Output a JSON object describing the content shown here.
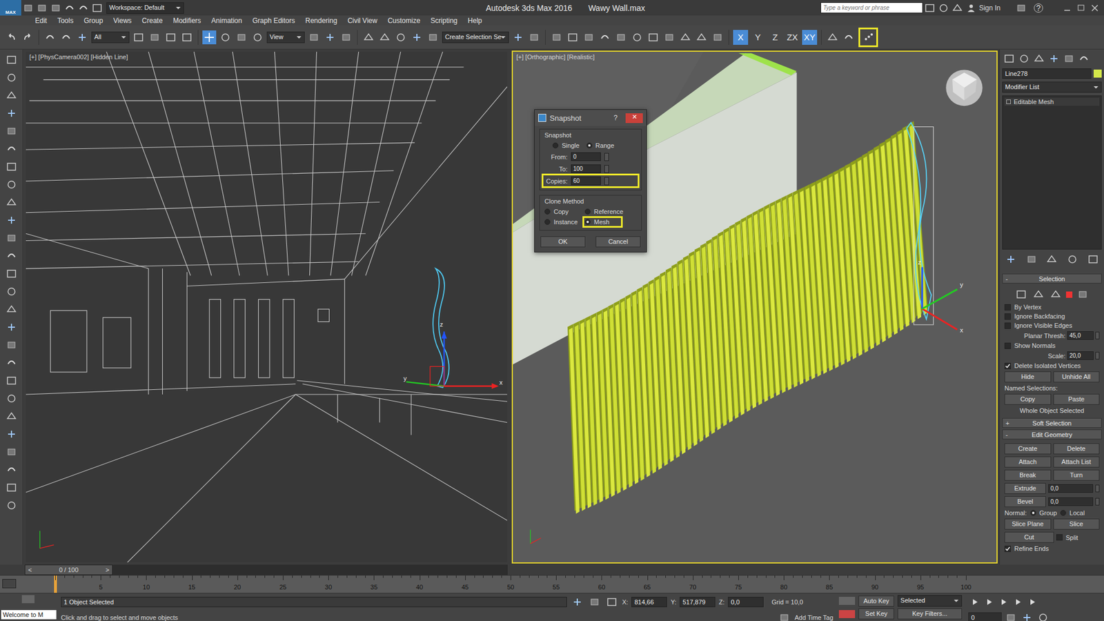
{
  "window": {
    "app_badge": "MAX",
    "workspace": "Workspace: Default",
    "title": "Autodesk 3ds Max 2016",
    "file": "Wawy Wall.max",
    "search_placeholder": "Type a keyword or phrase",
    "sign_in": "Sign In",
    "help": "?"
  },
  "menu": [
    "Edit",
    "Tools",
    "Group",
    "Views",
    "Create",
    "Modifiers",
    "Animation",
    "Graph Editors",
    "Rendering",
    "Civil View",
    "Customize",
    "Scripting",
    "Help"
  ],
  "toolbar": {
    "selection_filter": "All",
    "ref_coord": "View",
    "named_selection": "Create Selection Se",
    "axes": [
      {
        "label": "X",
        "selected": true
      },
      {
        "label": "Y",
        "selected": false
      },
      {
        "label": "Z",
        "selected": false
      },
      {
        "label": "ZX",
        "selected": false
      },
      {
        "label": "XY",
        "selected": true
      }
    ],
    "snapshot_highlighted": true
  },
  "viewports": [
    {
      "label": "[+] [PhysCamera002] [Hidden Line]",
      "active": false,
      "axes": [
        "x",
        "y",
        "z"
      ]
    },
    {
      "label": "[+] [Orthographic] [Realistic]",
      "active": true,
      "axes": [
        "x",
        "y",
        "z"
      ]
    }
  ],
  "snapshot": {
    "title": "Snapshot",
    "help": "?",
    "close": "✕",
    "group": "Snapshot",
    "modes": [
      {
        "label": "Single",
        "selected": false
      },
      {
        "label": "Range",
        "selected": true
      }
    ],
    "from": {
      "label": "From:",
      "value": "0"
    },
    "to": {
      "label": "To:",
      "value": "100"
    },
    "copies": {
      "label": "Copies:",
      "value": "60",
      "highlighted": true
    },
    "clone_group": "Clone Method",
    "methods": [
      {
        "label": "Copy",
        "selected": false,
        "highlighted": false
      },
      {
        "label": "Reference",
        "selected": false,
        "highlighted": false
      },
      {
        "label": "Instance",
        "selected": false,
        "highlighted": false
      },
      {
        "label": "Mesh",
        "selected": true,
        "highlighted": true
      }
    ],
    "buttons": [
      "OK",
      "Cancel"
    ]
  },
  "command_panel": {
    "object_name": "Line278",
    "object_color": "#d4e84a",
    "modifier_list": "Modifier List",
    "stack": [
      {
        "label": "Editable Mesh",
        "selected": false
      }
    ],
    "selection": {
      "header": "Selection",
      "collapse": "-",
      "options": [
        {
          "label": "By Vertex",
          "checked": false
        },
        {
          "label": "Ignore Backfacing",
          "checked": false
        },
        {
          "label": "Ignore Visible Edges",
          "checked": false
        }
      ],
      "planar_label": "Planar Thresh:",
      "planar_value": "45,0",
      "show_normals": {
        "label": "Show Normals",
        "checked": false
      },
      "scale_label": "Scale:",
      "scale_value": "20,0",
      "delete_isolated": {
        "label": "Delete Isolated Vertices",
        "checked": true
      },
      "buttons": [
        "Hide",
        "Unhide All"
      ],
      "named_label": "Named Selections:",
      "named_buttons": [
        "Copy",
        "Paste"
      ],
      "info": "Whole Object Selected"
    },
    "soft_selection": {
      "header": "Soft Selection",
      "collapse": "+"
    },
    "edit_geometry": {
      "header": "Edit Geometry",
      "collapse": "-",
      "button_rows": [
        [
          "Create",
          "Delete"
        ],
        [
          "Attach",
          "Attach List"
        ],
        [
          "Break",
          "Turn"
        ]
      ],
      "spinners": [
        {
          "label": "Extrude",
          "value": "0,0"
        },
        {
          "label": "Bevel",
          "value": "0,0"
        }
      ],
      "normal_label": "Normal:",
      "normal_modes": [
        {
          "label": "Group",
          "selected": true
        },
        {
          "label": "Local",
          "selected": false
        }
      ],
      "slice_buttons": [
        "Slice Plane",
        "Slice"
      ],
      "cut": "Cut",
      "split": {
        "label": "Split",
        "checked": false
      },
      "refine_ends": {
        "label": "Refine Ends",
        "checked": true
      }
    }
  },
  "timeline": {
    "position": "0 / 100",
    "prev": "<",
    "next": ">",
    "level": 0,
    "ticks": [
      "5",
      "10",
      "15",
      "20",
      "25",
      "30",
      "35",
      "40",
      "45",
      "50",
      "55",
      "60",
      "65",
      "70",
      "75",
      "80",
      "85",
      "90",
      "95",
      "100"
    ]
  },
  "status": {
    "maxscript": "Welcome to M",
    "selected": "1 Object Selected",
    "prompt": "Click and drag to select and move objects",
    "x_label": "X:",
    "x": "814,66",
    "y_label": "Y:",
    "y": "517,879",
    "z_label": "Z:",
    "z": "0,0",
    "grid": "Grid = 10,0",
    "add_time_tag": "Add Time Tag",
    "auto_key": "Auto Key",
    "set_key": "Set Key",
    "key_mode": "Selected",
    "key_filters": "Key Filters...",
    "frame": "0"
  }
}
